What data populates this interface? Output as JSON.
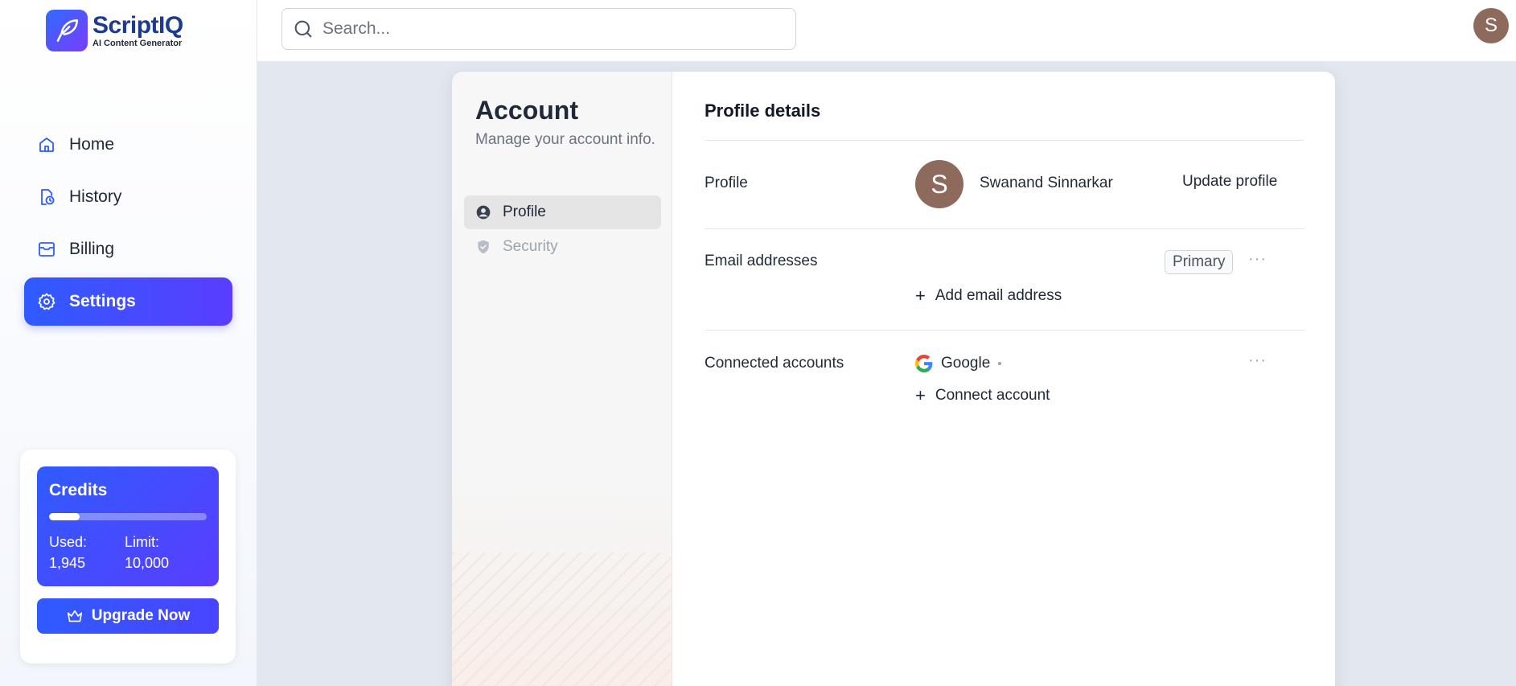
{
  "brand": {
    "name": "ScriptIQ",
    "tagline": "AI Content Generator",
    "accent": "#2f5bff"
  },
  "sidebar": {
    "items": [
      {
        "label": "Home",
        "icon": "home-icon"
      },
      {
        "label": "History",
        "icon": "history-icon"
      },
      {
        "label": "Billing",
        "icon": "billing-icon"
      },
      {
        "label": "Settings",
        "icon": "gear-icon",
        "active": true
      }
    ],
    "credits": {
      "title": "Credits",
      "used_label": "Used:",
      "used_value": "1,945",
      "limit_label": "Limit:",
      "limit_value": "10,000",
      "used_fraction": 0.1945
    },
    "upgrade_label": "Upgrade Now"
  },
  "topbar": {
    "search_placeholder": "Search...",
    "avatar_initial": "S"
  },
  "account": {
    "title": "Account",
    "subtitle": "Manage your account info.",
    "nav": [
      {
        "label": "Profile",
        "active": true
      },
      {
        "label": "Security",
        "active": false
      }
    ]
  },
  "profile_details": {
    "title": "Profile details",
    "profile": {
      "label": "Profile",
      "avatar_initial": "S",
      "name": "Swanand Sinnarkar",
      "update_label": "Update profile"
    },
    "email": {
      "label": "Email addresses",
      "badge": "Primary",
      "add_label": "Add email address",
      "more": "···"
    },
    "connected": {
      "label": "Connected accounts",
      "provider": "Google",
      "connect_label": "Connect account",
      "more": "···"
    }
  }
}
